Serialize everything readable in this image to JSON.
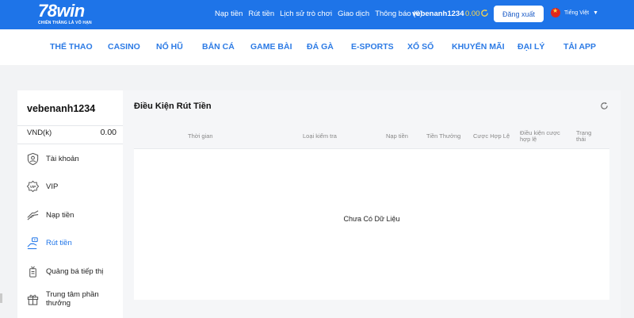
{
  "brand": {
    "name": "78win",
    "tagline": "CHIẾN THẮNG LÀ VÔ HẠN"
  },
  "header": {
    "links": [
      "Nạp tiền",
      "Rút tiền",
      "Lịch sử trò chơi",
      "Giao dịch",
      "Thông báo (0)"
    ],
    "username": "vebenanh1234",
    "balance": "0.00",
    "logout_label": "Đăng xuất",
    "language": "Tiếng Việt"
  },
  "nav": {
    "items": [
      "THỂ THAO",
      "CASINO",
      "NỔ HŨ",
      "BẮN CÁ",
      "GAME BÀI",
      "ĐÁ GÀ",
      "E-SPORTS",
      "XỔ SỐ",
      "KHUYẾN MÃI",
      "ĐẠI LÝ",
      "TẢI APP"
    ]
  },
  "sidebar": {
    "username": "vebenanh1234",
    "currency": "VND(k)",
    "amount": "0.00",
    "items": [
      {
        "label": "Tài khoản",
        "icon": "user-shield-icon"
      },
      {
        "label": "VIP",
        "icon": "vip-badge-icon"
      },
      {
        "label": "Nạp tiền",
        "icon": "deposit-icon"
      },
      {
        "label": "Rút tiền",
        "icon": "withdraw-icon",
        "active": true
      },
      {
        "label": "Quảng bá tiếp thị",
        "icon": "marketing-icon"
      },
      {
        "label": "Trung tâm phần thưởng",
        "icon": "gift-icon"
      }
    ]
  },
  "main": {
    "title": "Điều Kiện Rút Tiền",
    "columns": [
      "Thời gian",
      "Loại kiểm tra",
      "Nạp tiền",
      "Tiền Thưởng",
      "Cược Hợp Lệ",
      "Điều kiện cược hợp lệ",
      "Trạng thái"
    ],
    "empty_text": "Chưa Có Dữ Liệu"
  },
  "colors": {
    "brand_blue": "#1e74e8",
    "nav_text": "#2d7be5",
    "balance_gold": "#ffd84a"
  }
}
